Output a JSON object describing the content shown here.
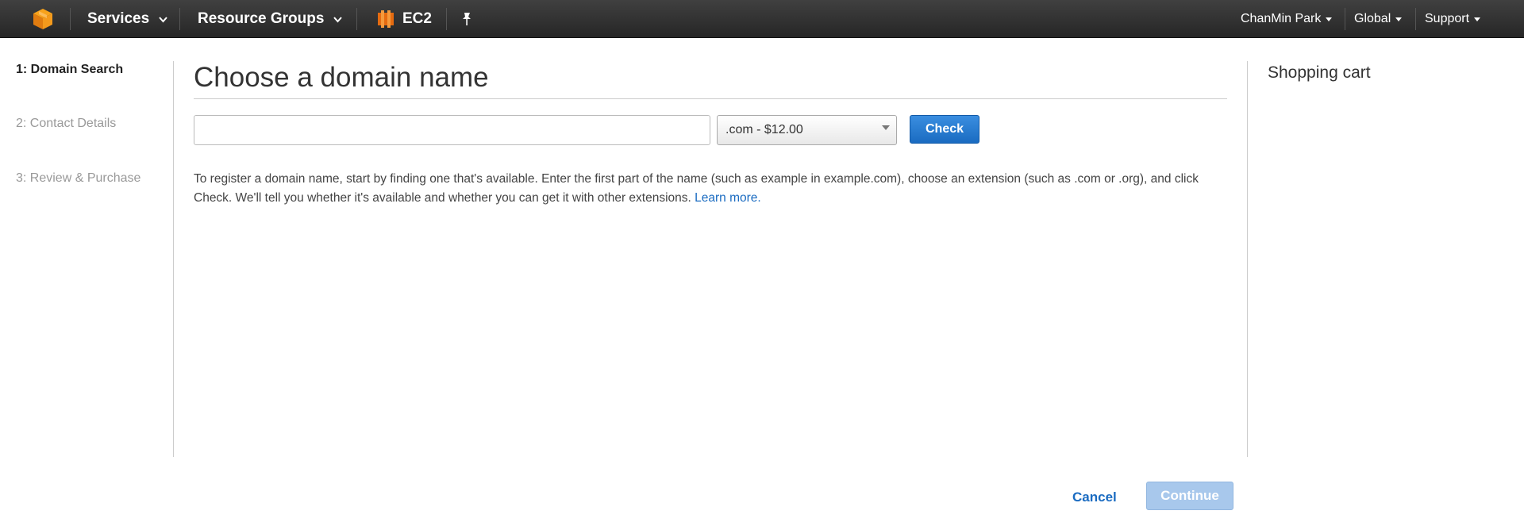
{
  "nav": {
    "services_label": "Services",
    "resource_groups_label": "Resource Groups",
    "ec2_label": "EC2",
    "user_label": "ChanMin Park",
    "region_label": "Global",
    "support_label": "Support",
    "logo_icon": "aws-cube-icon",
    "pin_icon": "pushpin-icon",
    "brand_color": "#f7981d"
  },
  "steps": [
    {
      "label": "1: Domain Search",
      "active": true
    },
    {
      "label": "2: Contact Details",
      "active": false
    },
    {
      "label": "3: Review & Purchase",
      "active": false
    }
  ],
  "main": {
    "title": "Choose a domain name",
    "domain_input_value": "",
    "tld_selected": ".com - $12.00",
    "check_label": "Check",
    "help_text": "To register a domain name, start by finding one that's available. Enter the first part of the name (such as example in example.com), choose an extension (such as .com or .org), and click Check. We'll tell you whether it's available and whether you can get it with other extensions.",
    "learn_more": "Learn more."
  },
  "cart": {
    "title": "Shopping cart"
  },
  "footer": {
    "cancel_label": "Cancel",
    "continue_label": "Continue"
  }
}
